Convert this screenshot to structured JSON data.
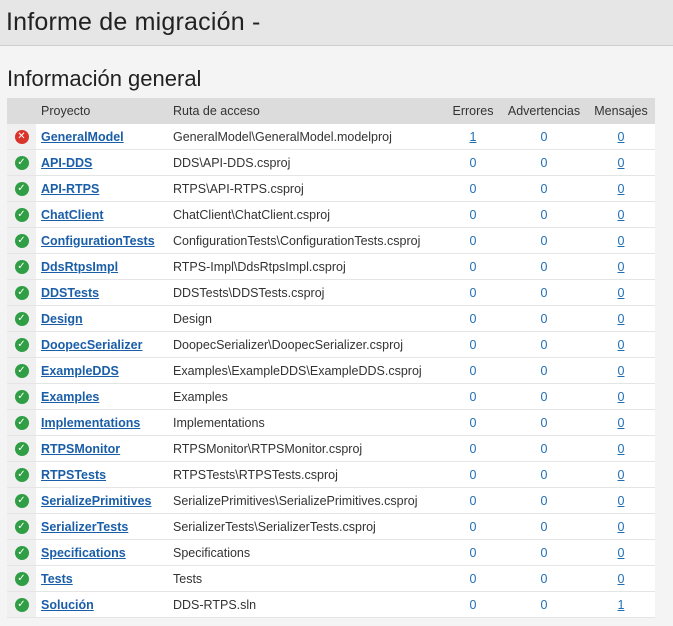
{
  "title": "Informe de migración -",
  "section_title": "Información general",
  "table": {
    "headers": {
      "project": "Proyecto",
      "path": "Ruta de acceso",
      "errors": "Errores",
      "warnings": "Advertencias",
      "messages": "Mensajes"
    },
    "rows": [
      {
        "status": "error",
        "project": "GeneralModel",
        "path": "GeneralModel\\GeneralModel.modelproj",
        "errors": "1",
        "warnings": "0",
        "messages": "0"
      },
      {
        "status": "ok",
        "project": "API-DDS",
        "path": "DDS\\API-DDS.csproj",
        "errors": "0",
        "warnings": "0",
        "messages": "0"
      },
      {
        "status": "ok",
        "project": "API-RTPS",
        "path": "RTPS\\API-RTPS.csproj",
        "errors": "0",
        "warnings": "0",
        "messages": "0"
      },
      {
        "status": "ok",
        "project": "ChatClient",
        "path": "ChatClient\\ChatClient.csproj",
        "errors": "0",
        "warnings": "0",
        "messages": "0"
      },
      {
        "status": "ok",
        "project": "ConfigurationTests",
        "path": "ConfigurationTests\\ConfigurationTests.csproj",
        "errors": "0",
        "warnings": "0",
        "messages": "0"
      },
      {
        "status": "ok",
        "project": "DdsRtpsImpl",
        "path": "RTPS-Impl\\DdsRtpsImpl.csproj",
        "errors": "0",
        "warnings": "0",
        "messages": "0"
      },
      {
        "status": "ok",
        "project": "DDSTests",
        "path": "DDSTests\\DDSTests.csproj",
        "errors": "0",
        "warnings": "0",
        "messages": "0"
      },
      {
        "status": "ok",
        "project": "Design",
        "path": "Design",
        "errors": "0",
        "warnings": "0",
        "messages": "0"
      },
      {
        "status": "ok",
        "project": "DoopecSerializer",
        "path": "DoopecSerializer\\DoopecSerializer.csproj",
        "errors": "0",
        "warnings": "0",
        "messages": "0"
      },
      {
        "status": "ok",
        "project": "ExampleDDS",
        "path": "Examples\\ExampleDDS\\ExampleDDS.csproj",
        "errors": "0",
        "warnings": "0",
        "messages": "0"
      },
      {
        "status": "ok",
        "project": "Examples",
        "path": "Examples",
        "errors": "0",
        "warnings": "0",
        "messages": "0"
      },
      {
        "status": "ok",
        "project": "Implementations",
        "path": "Implementations",
        "errors": "0",
        "warnings": "0",
        "messages": "0"
      },
      {
        "status": "ok",
        "project": "RTPSMonitor",
        "path": "RTPSMonitor\\RTPSMonitor.csproj",
        "errors": "0",
        "warnings": "0",
        "messages": "0"
      },
      {
        "status": "ok",
        "project": "RTPSTests",
        "path": "RTPSTests\\RTPSTests.csproj",
        "errors": "0",
        "warnings": "0",
        "messages": "0"
      },
      {
        "status": "ok",
        "project": "SerializePrimitives",
        "path": "SerializePrimitives\\SerializePrimitives.csproj",
        "errors": "0",
        "warnings": "0",
        "messages": "0"
      },
      {
        "status": "ok",
        "project": "SerializerTests",
        "path": "SerializerTests\\SerializerTests.csproj",
        "errors": "0",
        "warnings": "0",
        "messages": "0"
      },
      {
        "status": "ok",
        "project": "Specifications",
        "path": "Specifications",
        "errors": "0",
        "warnings": "0",
        "messages": "0"
      },
      {
        "status": "ok",
        "project": "Tests",
        "path": "Tests",
        "errors": "0",
        "warnings": "0",
        "messages": "0"
      },
      {
        "status": "ok",
        "project": "Solución",
        "path": "DDS-RTPS.sln",
        "errors": "0",
        "warnings": "0",
        "messages": "1"
      }
    ]
  },
  "icons": {
    "ok": "check-circle-icon",
    "error": "error-circle-icon"
  },
  "colors": {
    "ok": "#2f9e44",
    "error": "#d9342b",
    "link": "#1a5ea8"
  }
}
